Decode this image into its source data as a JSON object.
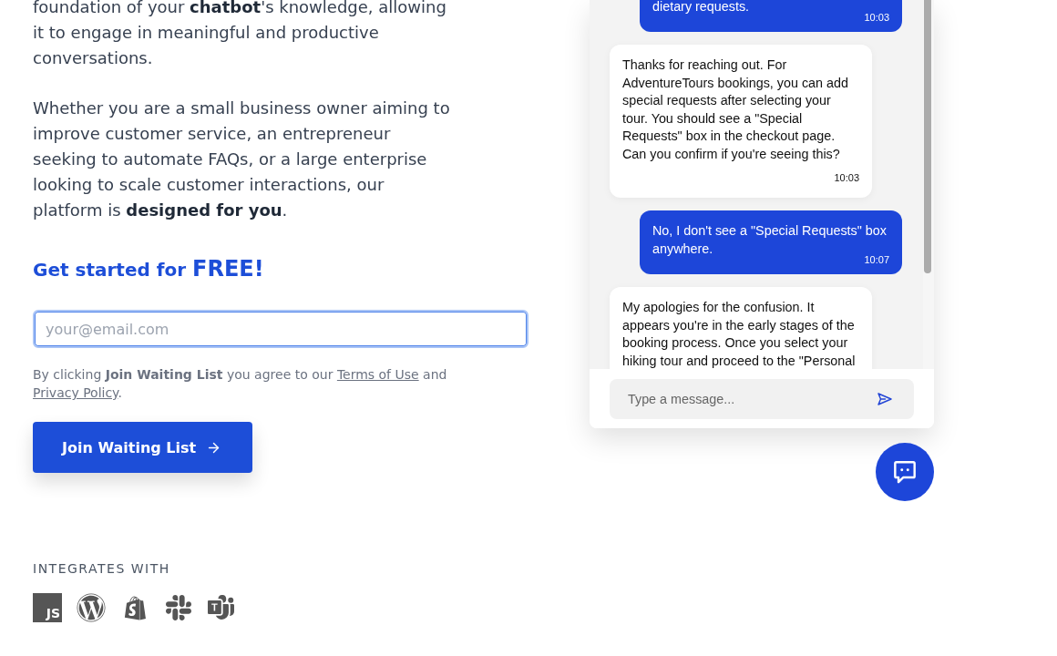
{
  "intro": {
    "paragraphs": [
      "foundation of your **chatbot**'s knowledge, allowing it to engage in meaningful and productive conversations.",
      "Whether you are a small business owner aiming to improve customer service, an entrepreneur seeking to automate FAQs, or a large enterprise looking to scale customer interactions, our platform is **designed for you**."
    ]
  },
  "signup": {
    "heading": {
      "text": "Get started for",
      "highlight": "FREE!"
    },
    "email": {
      "placeholder": "your@email.com",
      "focused": true
    },
    "consent": [
      {
        "kind": "text",
        "text": "By clicking **Join Waiting List** you agree to our "
      },
      {
        "kind": "link",
        "text": "Terms of Use"
      },
      {
        "kind": "text",
        "text": " and "
      },
      {
        "kind": "link",
        "text": "Privacy Policy"
      },
      {
        "kind": "text",
        "text": "."
      }
    ],
    "button": {
      "label": "Join Waiting List"
    }
  },
  "integrations": {
    "label": "INTEGRATES WITH",
    "js_logo": "JS"
  },
  "chat": {
    "messages": [
      {
        "kind": "user",
        "text": "dietary requests.",
        "time": "10:03"
      },
      {
        "kind": "bot",
        "text": "Thanks for reaching out. For AdventureTours bookings, you can add special requests after selecting your tour. You should see a \"Special Requests\" box in the checkout page. Can you confirm if you're seeing this?",
        "time": "10:03"
      },
      {
        "kind": "user",
        "text": "No, I don't see a \"Special Requests\" box anywhere.",
        "time": "10:07"
      },
      {
        "kind": "bot",
        "text": "My apologies for the confusion. It appears you're in the early stages of the booking process. Once you select your hiking tour and proceed to the \"Personal"
      }
    ],
    "composer": {
      "placeholder": "Type a message..."
    }
  }
}
